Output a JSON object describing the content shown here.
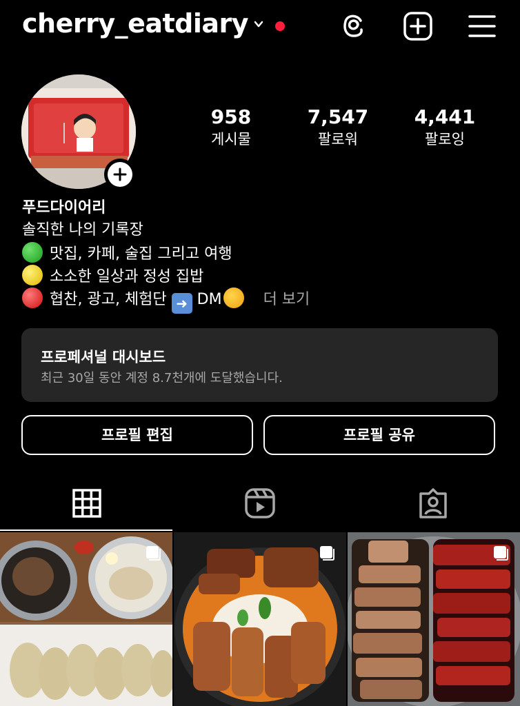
{
  "header": {
    "username": "cherry_eatdiary",
    "icons": [
      "chevron-down-icon",
      "notification-dot",
      "threads-icon",
      "create-post-icon",
      "menu-icon"
    ]
  },
  "stats": [
    {
      "value": "958",
      "label": "게시물"
    },
    {
      "value": "7,547",
      "label": "팔로워"
    },
    {
      "value": "4,441",
      "label": "팔로잉"
    }
  ],
  "bio": {
    "name": "푸드다이어리",
    "line1": "솔직한 나의 기록장",
    "line2": "맛집, 카페, 술집 그리고 여행",
    "line3": "소소한 일상과 정성 집밥",
    "line4": "협찬, 광고, 체험단",
    "line4_dm": "DM",
    "more": "더 보기"
  },
  "dashboard": {
    "title": "프로페셔널 대시보드",
    "subtitle": "최근 30일 동안 계정 8.7천개에 도달했습니다."
  },
  "buttons": {
    "edit_profile": "프로필 편집",
    "share_profile": "프로필 공유"
  },
  "tabs": [
    "grid-tab",
    "reels-tab",
    "tagged-tab"
  ],
  "colors": {
    "background": "#000000",
    "card": "#262626",
    "notification_dot": "#ff1e3c",
    "muted_text": "#a8a8a8"
  }
}
